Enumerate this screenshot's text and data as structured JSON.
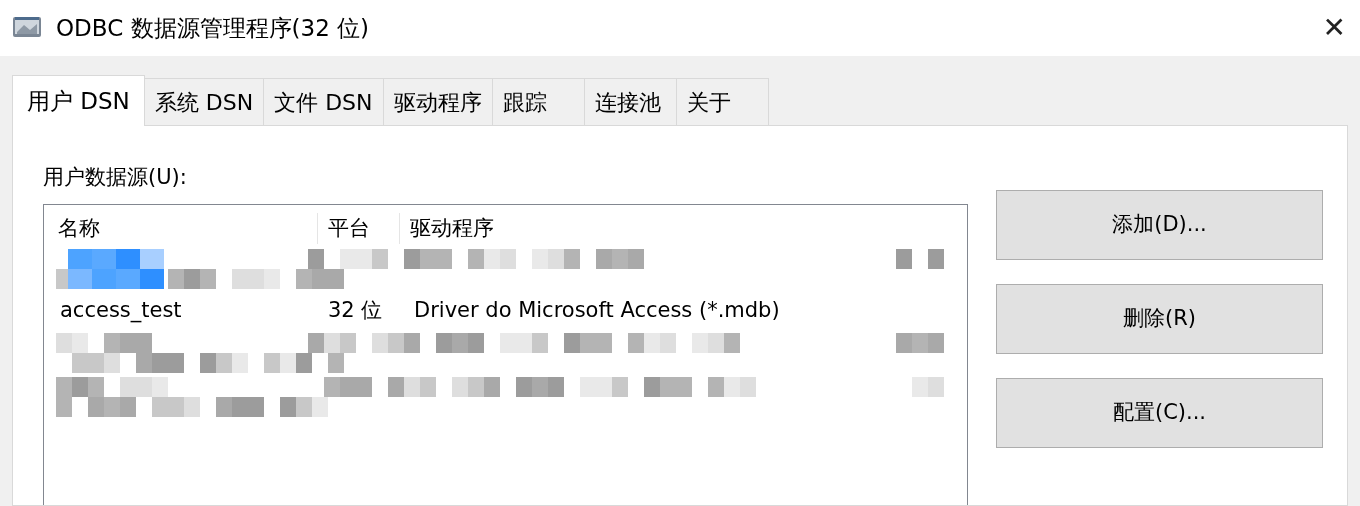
{
  "window": {
    "title": "ODBC 数据源管理程序(32 位)",
    "close": "✕"
  },
  "tabs": [
    {
      "label": "用户 DSN",
      "selected": true
    },
    {
      "label": "系统 DSN",
      "selected": false
    },
    {
      "label": "文件 DSN",
      "selected": false
    },
    {
      "label": "驱动程序",
      "selected": false
    },
    {
      "label": "跟踪",
      "selected": false
    },
    {
      "label": "连接池",
      "selected": false
    },
    {
      "label": "关于",
      "selected": false
    }
  ],
  "list_label": "用户数据源(U):",
  "table": {
    "columns": [
      "名称",
      "平台",
      "驱动程序"
    ],
    "rows": [
      {
        "kind": "obscured",
        "selected": true
      },
      {
        "kind": "entry",
        "selected": false,
        "cells": [
          "access_test",
          "32 位",
          "Driver do Microsoft Access (*.mdb)"
        ]
      },
      {
        "kind": "obscured",
        "selected": false
      },
      {
        "kind": "obscured",
        "selected": false
      }
    ]
  },
  "buttons": [
    "添加(D)...",
    "删除(R)",
    "配置(C)..."
  ]
}
